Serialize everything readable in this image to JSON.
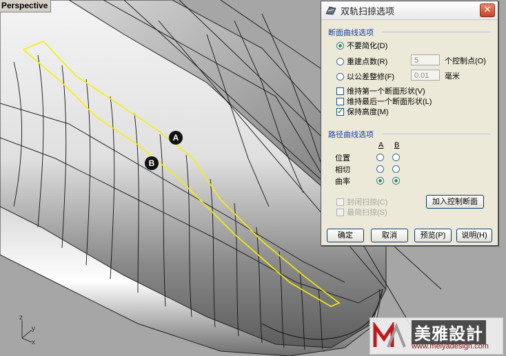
{
  "viewport": {
    "label": "Perspective",
    "axes": {
      "z": "z",
      "y": "y",
      "x": "x"
    },
    "markers": {
      "a": "A",
      "b": "B"
    }
  },
  "dialog": {
    "title": "双轨扫掠选项",
    "close_glyph": "✕",
    "section_cross": "断面曲线选项",
    "opt_no_simplify": "不要简化(D)",
    "opt_rebuild": "重建点数(R)",
    "rebuild_value": "5",
    "rebuild_unit": "个控制点(O)",
    "opt_refit": "以公差整修(F)",
    "refit_value": "0.01",
    "refit_unit": "毫米",
    "chk_keep_first": "维持第一个断面形状(V)",
    "chk_keep_last": "维持最后一个断面形状(L)",
    "chk_keep_height": "保持高度(M)",
    "section_rail": "路径曲线选项",
    "col_a": "A",
    "col_b": "B",
    "row_position": "位置",
    "row_tangent": "相切",
    "row_curvature": "曲率",
    "chk_closed": "封闭扫掠(C)",
    "chk_simple": "最简扫掠(S)",
    "btn_add_slash": "加入控制断面",
    "btn_ok": "确定",
    "btn_cancel": "取消",
    "btn_preview": "预览(P)",
    "btn_help": "说明(H)",
    "state": {
      "cross_section_option": "no_simplify",
      "keep_first_shape": false,
      "keep_last_shape": false,
      "maintain_height": true,
      "rail_a_continuity": "curvature",
      "rail_b_continuity": "curvature",
      "closed_sweep": false,
      "simple_sweep": false
    }
  },
  "watermark": {
    "brand": "美雅設計",
    "url": "www.meiyadesign.com"
  },
  "colors": {
    "dialog_bg": "#ece9d8",
    "section_title": "#1a3fa8",
    "highlight_curve": "#f5f000",
    "viewport_bg": "#a6a6a6"
  }
}
